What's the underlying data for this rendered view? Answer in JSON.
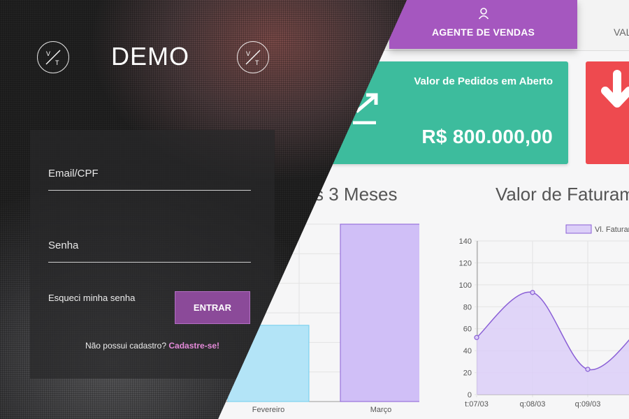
{
  "tabs": {
    "active_label": "AGENTE DE VENDAS",
    "active_icon": "user-icon",
    "next_label": "VAL"
  },
  "cards": {
    "green": {
      "title": "Valor de Pedidos em Aberto",
      "value": "R$ 800.000,00",
      "icon": "trend-up-icon",
      "color": "#3dbc9d"
    },
    "red": {
      "icon": "arrow-down-icon",
      "color": "#ee4a4f"
    }
  },
  "charts": {
    "bar_title": "s 3 Meses",
    "line_title": "Valor de Faturam",
    "legend_label": "Vl. Faturam"
  },
  "chart_data": [
    {
      "type": "bar",
      "categories": [
        "Fevereiro",
        "Março"
      ],
      "values": [
        43,
        100
      ],
      "colors": [
        "#b3e4f7",
        "#d0bff7"
      ],
      "title": "s 3 Meses",
      "grid": true
    },
    {
      "type": "area",
      "x": [
        "t:07/03",
        "q:08/03",
        "q:09/03",
        ""
      ],
      "series": [
        {
          "name": "Vl. Faturam",
          "values": [
            52,
            93,
            23,
            64
          ]
        }
      ],
      "ylim": [
        0,
        140
      ],
      "yticks": [
        0,
        20,
        40,
        60,
        80,
        100,
        120,
        140
      ],
      "title": "Valor de Faturam",
      "grid": true,
      "legend": "top",
      "color": "#8a5fd6"
    }
  ],
  "login": {
    "logo_text": "DEMO",
    "logo_badge_icon": "vt-monogram-icon",
    "email_label": "Email/CPF",
    "password_label": "Senha",
    "forgot_label": "Esqueci minha senha",
    "enter_label": "ENTRAR",
    "signup_prompt": "Não possui cadastro?",
    "signup_link": "Cadastre-se!",
    "accent": "#8b4a99"
  }
}
